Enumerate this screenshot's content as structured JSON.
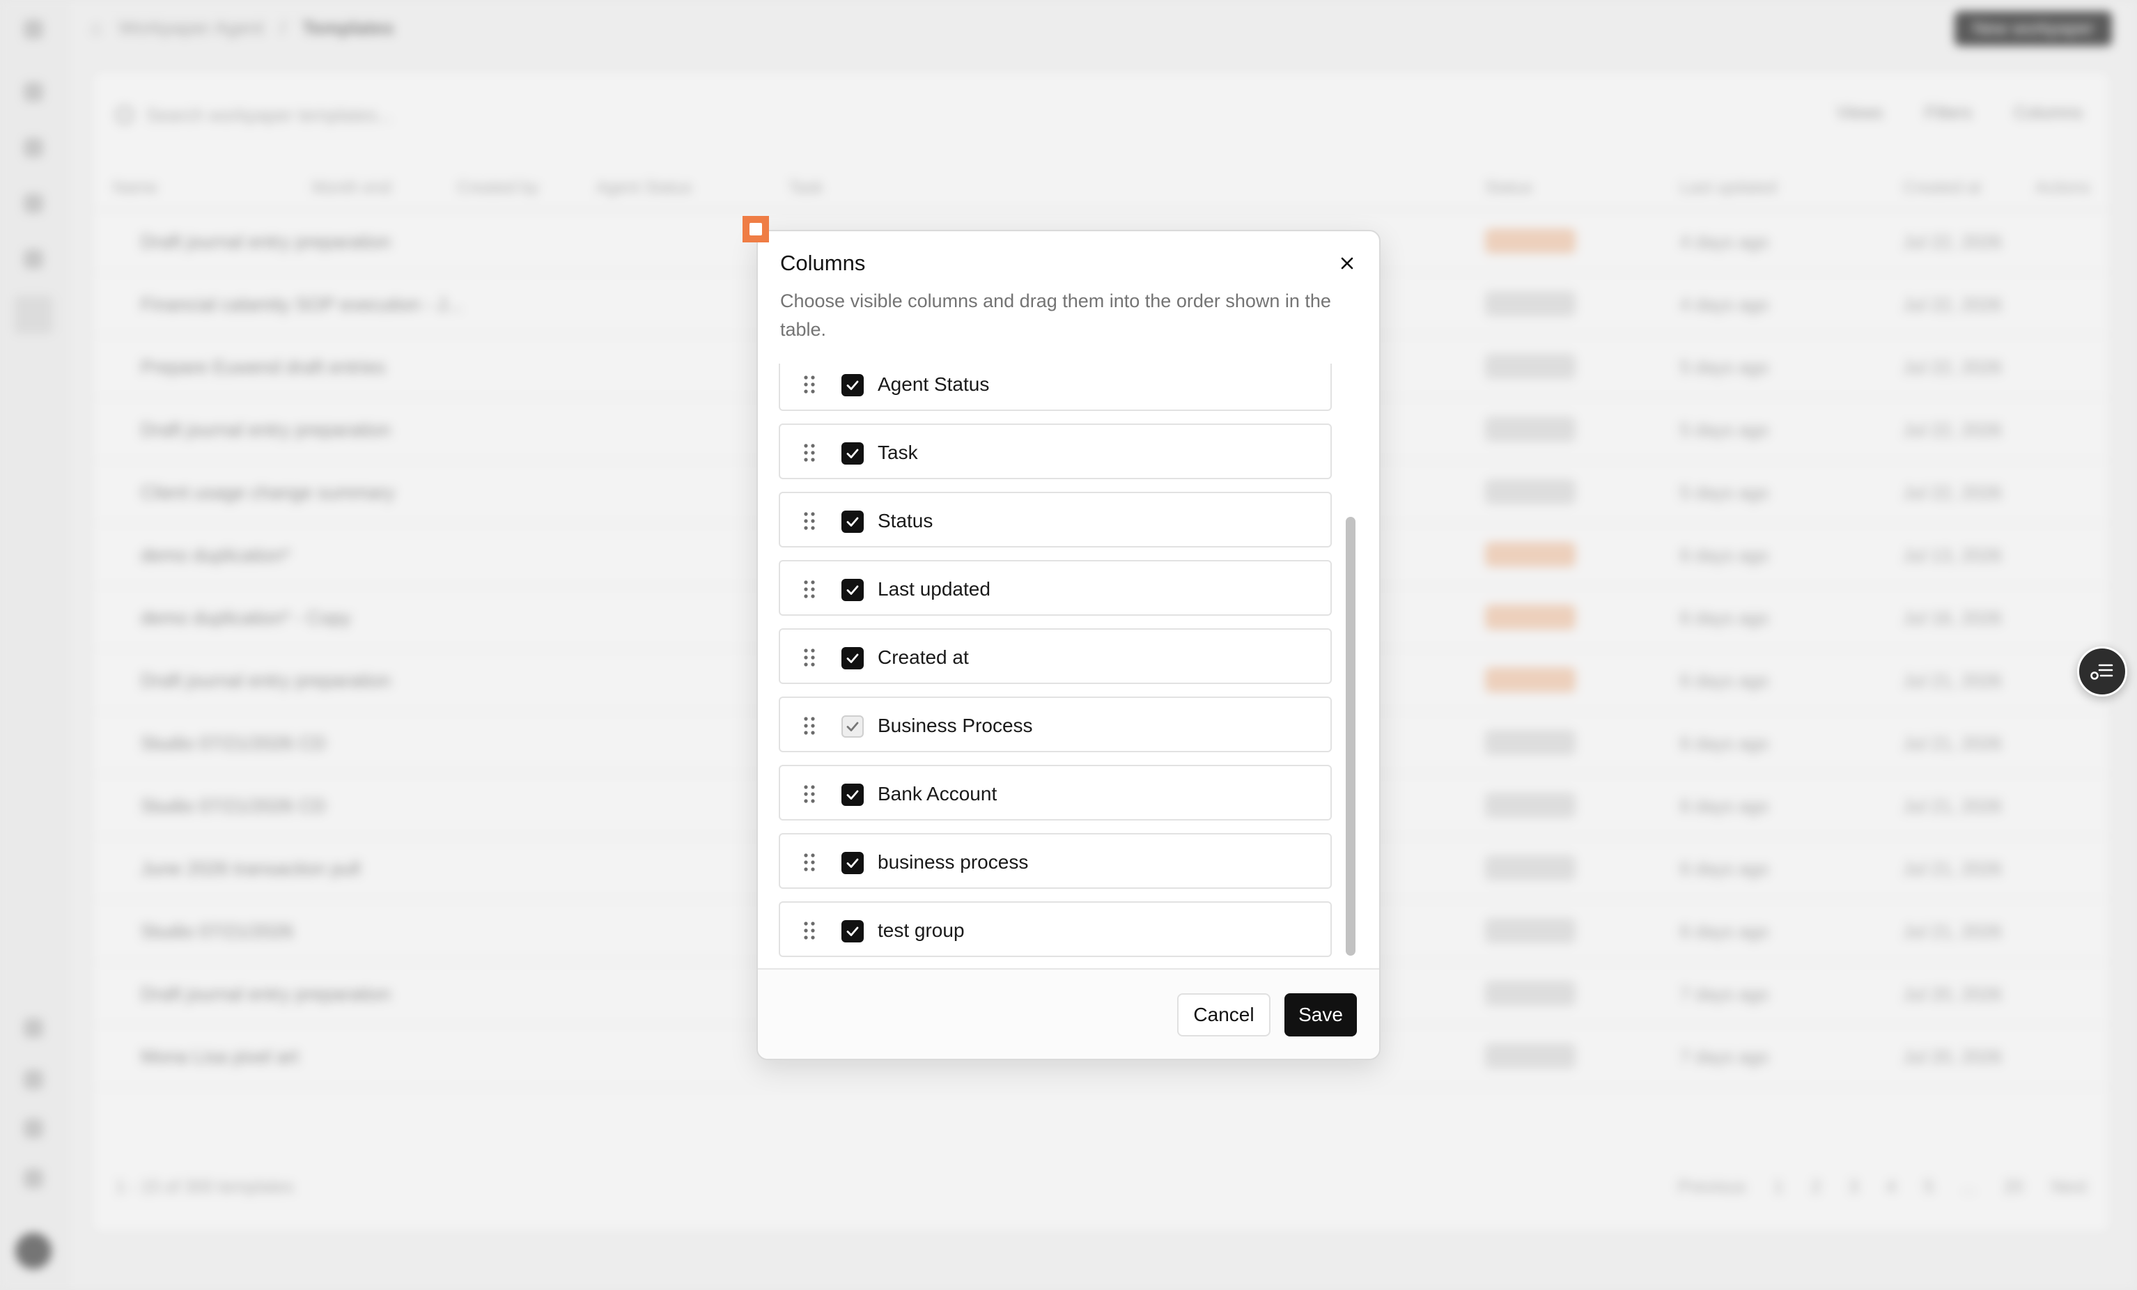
{
  "background": {
    "breadcrumb": [
      "Workpaper Agent",
      "Templates"
    ],
    "new_button": "New workpaper",
    "search_placeholder": "Search workpaper templates...",
    "tools": [
      "Views",
      "Filters",
      "Columns"
    ],
    "headers": [
      "Name",
      "Month end",
      "Created by",
      "Agent Status",
      "Task",
      "Status",
      "Last updated",
      "Created at",
      "Actions"
    ],
    "rows": [
      {
        "name": "Draft journal entry preparation",
        "pill": "orange",
        "time": "4 days ago",
        "date": "Jul 22, 2026"
      },
      {
        "name": "Financial calamity SOP execution - J...",
        "pill": "grey",
        "time": "4 days ago",
        "date": "Jul 22, 2026"
      },
      {
        "name": "Prepare Euwend draft entries",
        "pill": "grey",
        "time": "5 days ago",
        "date": "Jul 22, 2026"
      },
      {
        "name": "Draft journal entry preparation",
        "pill": "grey",
        "time": "5 days ago",
        "date": "Jul 22, 2026"
      },
      {
        "name": "Client usage change summary",
        "pill": "grey",
        "time": "5 days ago",
        "date": "Jul 22, 2026"
      },
      {
        "name": "demo duplication*",
        "pill": "orange",
        "time": "6 days ago",
        "date": "Jul 13, 2026"
      },
      {
        "name": "demo duplication* - Copy",
        "pill": "orange",
        "time": "6 days ago",
        "date": "Jul 16, 2026"
      },
      {
        "name": "Draft journal entry preparation",
        "pill": "orange",
        "time": "6 days ago",
        "date": "Jul 21, 2026"
      },
      {
        "name": "Studio 07/21/2026 CD",
        "pill": "grey",
        "time": "6 days ago",
        "date": "Jul 21, 2026"
      },
      {
        "name": "Studio 07/21/2026 CD",
        "pill": "grey",
        "time": "6 days ago",
        "date": "Jul 21, 2026"
      },
      {
        "name": "June 2026 transaction pull",
        "pill": "grey",
        "time": "6 days ago",
        "date": "Jul 21, 2026"
      },
      {
        "name": "Studio 07/21/2026",
        "pill": "grey",
        "time": "6 days ago",
        "date": "Jul 21, 2026"
      },
      {
        "name": "Draft journal entry preparation",
        "pill": "grey",
        "time": "7 days ago",
        "date": "Jul 20, 2026"
      },
      {
        "name": "Mona Lisa pixel art",
        "pill": "grey",
        "time": "7 days ago",
        "date": "Jul 20, 2026"
      }
    ],
    "footer_count": "1 - 15 of 300 templates",
    "pagination": [
      "Previous",
      "1",
      "2",
      "3",
      "4",
      "5",
      "...",
      "20",
      "Next"
    ]
  },
  "modal": {
    "title": "Columns",
    "description": "Choose visible columns and drag them into the order shown in the table.",
    "items": [
      {
        "label": "Agent Status",
        "checked": true,
        "muted": false
      },
      {
        "label": "Task",
        "checked": true,
        "muted": false
      },
      {
        "label": "Status",
        "checked": true,
        "muted": false
      },
      {
        "label": "Last updated",
        "checked": true,
        "muted": false
      },
      {
        "label": "Created at",
        "checked": true,
        "muted": false
      },
      {
        "label": "Business Process",
        "checked": true,
        "muted": true
      },
      {
        "label": "Bank Account",
        "checked": true,
        "muted": false
      },
      {
        "label": "business process",
        "checked": true,
        "muted": false
      },
      {
        "label": "test group",
        "checked": true,
        "muted": false
      }
    ],
    "cancel_label": "Cancel",
    "save_label": "Save"
  },
  "icons": {
    "close": "close-icon",
    "drag": "drag-handle-icon",
    "check": "check-icon",
    "fab": "list-settings-icon",
    "marker": "record-marker-icon"
  },
  "colors": {
    "primary": "#111111",
    "marker": "#ef7d45",
    "muted_text": "#747474"
  }
}
